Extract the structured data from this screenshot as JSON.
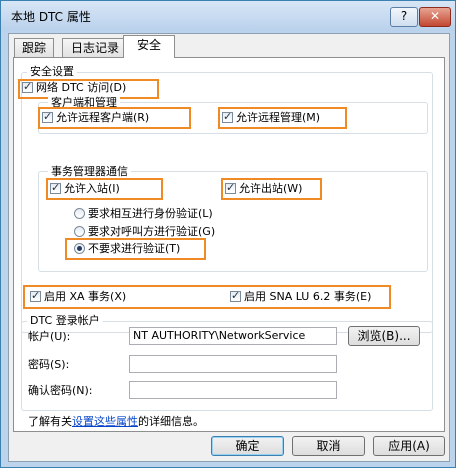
{
  "window": {
    "title": "本地 DTC 属性",
    "help_button": "?",
    "close_button": "✕"
  },
  "tabs": [
    {
      "label": "跟踪"
    },
    {
      "label": "日志记录"
    },
    {
      "label": "安全"
    }
  ],
  "security": {
    "group_label": "安全设置",
    "network_dtc_access": {
      "label": "网络 DTC 访问(D)",
      "checked": true
    },
    "client_admin": {
      "group_label": "客户端和管理",
      "allow_remote_clients": {
        "label": "允许远程客户端(R)",
        "checked": true
      },
      "allow_remote_admin": {
        "label": "允许远程管理(M)",
        "checked": true
      }
    },
    "tm_comm": {
      "group_label": "事务管理器通信",
      "allow_inbound": {
        "label": "允许入站(I)",
        "checked": true
      },
      "allow_outbound": {
        "label": "允许出站(W)",
        "checked": true
      },
      "auth_options": [
        {
          "label": "要求相互进行身份验证(L)",
          "selected": false
        },
        {
          "label": "要求对呼叫方进行验证(G)",
          "selected": false
        },
        {
          "label": "不要求进行验证(T)",
          "selected": true
        }
      ]
    },
    "enable_xa": {
      "label": "启用 XA 事务(X)",
      "checked": true
    },
    "enable_sna": {
      "label": "启用 SNA LU 6.2 事务(E)",
      "checked": true
    }
  },
  "logon": {
    "group_label": "DTC 登录帐户",
    "account_label": "帐户(U):",
    "account_value": "NT AUTHORITY\\NetworkService",
    "browse_button": "浏览(B)...",
    "password_label": "密码(S):",
    "confirm_label": "确认密码(N):"
  },
  "info": {
    "prefix": "了解有关",
    "link": "设置这些属性",
    "suffix": "的详细信息。"
  },
  "footer": {
    "ok": "确定",
    "cancel": "取消",
    "apply": "应用(A)"
  },
  "colors": {
    "highlight": "#f08a24",
    "title_bar": "#bcd3ec",
    "link": "#0645c8"
  }
}
